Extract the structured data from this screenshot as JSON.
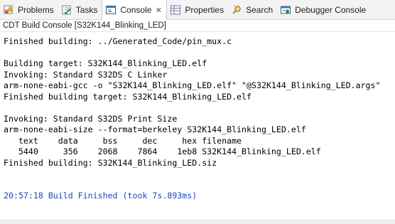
{
  "tabs": [
    {
      "label": "Problems",
      "icon": "problems-icon"
    },
    {
      "label": "Tasks",
      "icon": "tasks-icon"
    },
    {
      "label": "Console",
      "icon": "console-icon",
      "active": true
    },
    {
      "label": "Properties",
      "icon": "properties-icon"
    },
    {
      "label": "Search",
      "icon": "search-icon"
    },
    {
      "label": "Debugger Console",
      "icon": "debugger-console-icon"
    }
  ],
  "console_title": "CDT Build Console [S32K144_Blinking_LED]",
  "console_lines": [
    "Finished building: ../Generated_Code/pin_mux.c",
    "",
    "Building target: S32K144_Blinking_LED.elf",
    "Invoking: Standard S32DS C Linker",
    "arm-none-eabi-gcc -o \"S32K144_Blinking_LED.elf\" \"@S32K144_Blinking_LED.args\"",
    "Finished building target: S32K144_Blinking_LED.elf",
    "",
    "Invoking: Standard S32DS Print Size",
    "arm-none-eabi-size --format=berkeley S32K144_Blinking_LED.elf",
    "   text    data     bss     dec     hex filename",
    "   5440     356    2068    7864    1eb8 S32K144_Blinking_LED.elf",
    "Finished building: S32K144_Blinking_LED.siz",
    "",
    "",
    "20:57:18 Build Finished (took 7s.893ms)"
  ],
  "colors": {
    "status_line": "#1a49b8",
    "text": "#000000"
  }
}
